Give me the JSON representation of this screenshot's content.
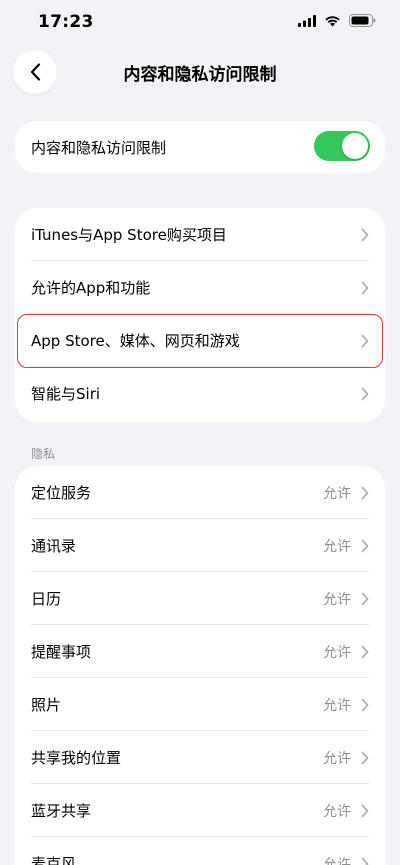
{
  "status_bar": {
    "time": "17:23",
    "icons": [
      "signal-icon",
      "wifi-icon",
      "battery-icon"
    ]
  },
  "nav": {
    "back_icon": "chevron-left-icon",
    "title": "内容和隐私访问限制"
  },
  "main_toggle": {
    "label": "内容和隐私访问限制",
    "on": true,
    "color": "#34c759"
  },
  "restrictions": {
    "items": [
      {
        "label": "iTunes与App Store购买项目"
      },
      {
        "label": "允许的App和功能"
      },
      {
        "label": "App Store、媒体、网页和游戏",
        "highlighted": true
      },
      {
        "label": "智能与Siri"
      }
    ],
    "highlight_color": "#e53935"
  },
  "privacy": {
    "header": "隐私",
    "items": [
      {
        "label": "定位服务",
        "value": "允许"
      },
      {
        "label": "通讯录",
        "value": "允许"
      },
      {
        "label": "日历",
        "value": "允许"
      },
      {
        "label": "提醒事项",
        "value": "允许"
      },
      {
        "label": "照片",
        "value": "允许"
      },
      {
        "label": "共享我的位置",
        "value": "允许"
      },
      {
        "label": "蓝牙共享",
        "value": "允许"
      },
      {
        "label": "麦克风",
        "value": "允许"
      }
    ]
  }
}
